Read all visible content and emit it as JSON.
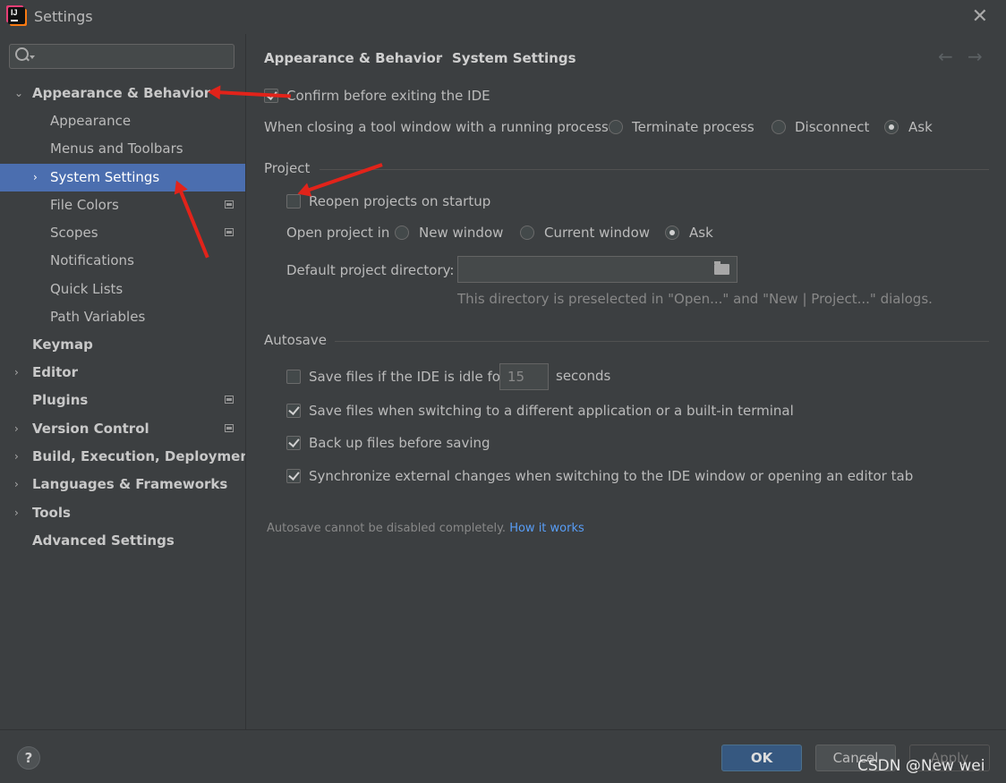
{
  "window": {
    "title": "Settings"
  },
  "sidebar": {
    "search_placeholder": "",
    "items": [
      {
        "label": "Appearance & Behavior",
        "bold": true,
        "chevron": "⌄"
      },
      {
        "label": "Appearance"
      },
      {
        "label": "Menus and Toolbars"
      },
      {
        "label": "System Settings",
        "chevron": "›",
        "selected": true
      },
      {
        "label": "File Colors",
        "badge": true
      },
      {
        "label": "Scopes",
        "badge": true
      },
      {
        "label": "Notifications"
      },
      {
        "label": "Quick Lists"
      },
      {
        "label": "Path Variables"
      },
      {
        "label": "Keymap",
        "bold": true
      },
      {
        "label": "Editor",
        "bold": true,
        "chevron": "›"
      },
      {
        "label": "Plugins",
        "bold": true,
        "badge": true
      },
      {
        "label": "Version Control",
        "bold": true,
        "chevron": "›",
        "badge": true
      },
      {
        "label": "Build, Execution, Deployment",
        "bold": true,
        "chevron": "›"
      },
      {
        "label": "Languages & Frameworks",
        "bold": true,
        "chevron": "›"
      },
      {
        "label": "Tools",
        "bold": true,
        "chevron": "›"
      },
      {
        "label": "Advanced Settings",
        "bold": true
      }
    ]
  },
  "breadcrumb": {
    "parent": "Appearance & Behavior",
    "separator": "›",
    "current": "System Settings",
    "back": "←",
    "forward": "→"
  },
  "general": {
    "confirm_exit": {
      "label": "Confirm before exiting the IDE",
      "checked": true
    },
    "closing_tool_window": {
      "label": "When closing a tool window with a running process:",
      "options": [
        "Terminate process",
        "Disconnect",
        "Ask"
      ],
      "selected": "Ask"
    }
  },
  "project": {
    "section_title": "Project",
    "reopen": {
      "label": "Reopen projects on startup",
      "checked": false
    },
    "open_in": {
      "label": "Open project in",
      "options": [
        "New window",
        "Current window",
        "Ask"
      ],
      "selected": "Ask"
    },
    "default_dir": {
      "label": "Default project directory:",
      "value": "",
      "hint": "This directory is preselected in \"Open...\" and \"New | Project...\" dialogs."
    }
  },
  "autosave": {
    "section_title": "Autosave",
    "idle": {
      "label": "Save files if the IDE is idle for",
      "value": "15",
      "unit": "seconds",
      "checked": false
    },
    "switching": {
      "label": "Save files when switching to a different application or a built-in terminal",
      "checked": true
    },
    "backup": {
      "label": "Back up files before saving",
      "checked": true
    },
    "sync": {
      "label": "Synchronize external changes when switching to the IDE window or opening an editor tab",
      "checked": true
    },
    "note": "Autosave cannot be disabled completely.",
    "note_link": "How it works"
  },
  "buttons": {
    "help": "?",
    "ok": "OK",
    "cancel": "Cancel",
    "apply": "Apply"
  },
  "watermark": "CSDN @New wei",
  "colors": {
    "background": "#3c3f41",
    "selection": "#4b6eaf",
    "link": "#589df6",
    "annotation": "#e2231a",
    "ok_button": "#365880"
  }
}
